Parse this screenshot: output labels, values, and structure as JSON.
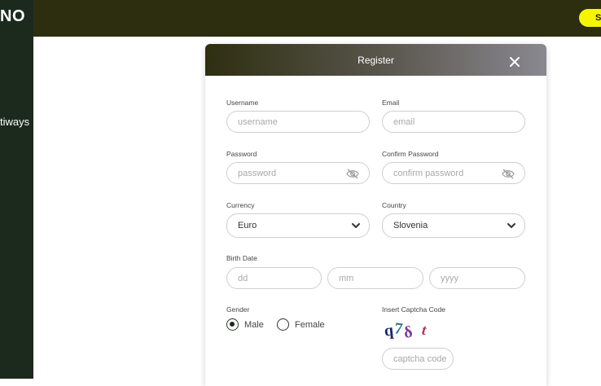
{
  "sidebar": {
    "logo": "NO",
    "nav_item": "tiways"
  },
  "topbar": {
    "signup_label": "SI"
  },
  "modal": {
    "title": "Register",
    "username_label": "Username",
    "username_placeholder": "username",
    "email_label": "Email",
    "email_placeholder": "email",
    "password_label": "Password",
    "password_placeholder": "password",
    "confirm_label": "Confirm Password",
    "confirm_placeholder": "confirm password",
    "currency_label": "Currency",
    "currency_value": "Euro",
    "country_label": "Country",
    "country_value": "Slovenia",
    "birth_label": "Birth Date",
    "dd_placeholder": "dd",
    "mm_placeholder": "mm",
    "yyyy_placeholder": "yyyy",
    "gender_label": "Gender",
    "male_label": "Male",
    "female_label": "Female",
    "captcha_label": "Insert Captcha Code",
    "captcha_code": "q7δt",
    "captcha_placeholder": "captcha code"
  }
}
